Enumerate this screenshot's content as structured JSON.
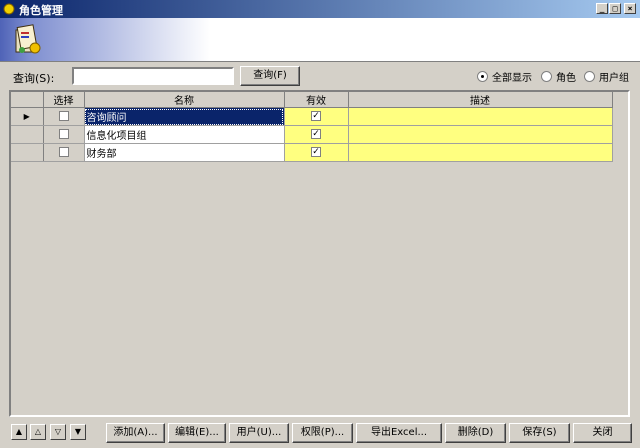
{
  "window": {
    "title": "角色管理",
    "controls": {
      "minimize": "_",
      "restore": "□",
      "close": "×"
    }
  },
  "search": {
    "label": "查询(S):",
    "value": "",
    "button": "查询(F)"
  },
  "filter": {
    "options": [
      {
        "label": "全部显示",
        "selected": true
      },
      {
        "label": "角色",
        "selected": false
      },
      {
        "label": "用户组",
        "selected": false
      }
    ]
  },
  "grid": {
    "columns": [
      "选择",
      "名称",
      "有效",
      "描述"
    ],
    "rows": [
      {
        "indicator": "▶",
        "selected": false,
        "name": "咨询顾问",
        "valid": true,
        "description": ""
      },
      {
        "indicator": "",
        "selected": false,
        "name": "信息化项目组",
        "valid": true,
        "description": ""
      },
      {
        "indicator": "",
        "selected": false,
        "name": "财务部",
        "valid": true,
        "description": ""
      }
    ]
  },
  "nav": {
    "first": "▲",
    "up": "△",
    "down": "▽",
    "last": "▼"
  },
  "buttons": {
    "add": "添加(A)...",
    "edit": "编辑(E)...",
    "users": "用户(U)...",
    "permissions": "权限(P)...",
    "export": "导出Excel...",
    "delete": "删除(D)",
    "save": "保存(S)",
    "close": "关闭"
  }
}
